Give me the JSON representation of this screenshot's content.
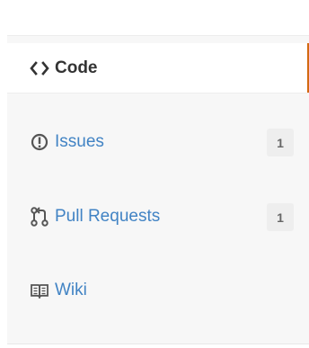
{
  "repository_nav": {
    "items": [
      {
        "key": "code",
        "label": "Code",
        "icon": "code-icon",
        "selected": true,
        "count": ""
      },
      {
        "key": "issues",
        "label": "Issues",
        "icon": "issue-icon",
        "selected": false,
        "count": "1"
      },
      {
        "key": "pull_requests",
        "label": "Pull Requests",
        "icon": "pull-request-icon",
        "selected": false,
        "count": "1"
      },
      {
        "key": "wiki",
        "label": "Wiki",
        "icon": "book-icon",
        "selected": false,
        "count": ""
      }
    ]
  },
  "colors": {
    "selected_accent": "#d26911",
    "link": "#4183c4",
    "selected_text": "#333333",
    "nav_background": "#f7f7f7",
    "counter_background": "#eeeeee"
  }
}
